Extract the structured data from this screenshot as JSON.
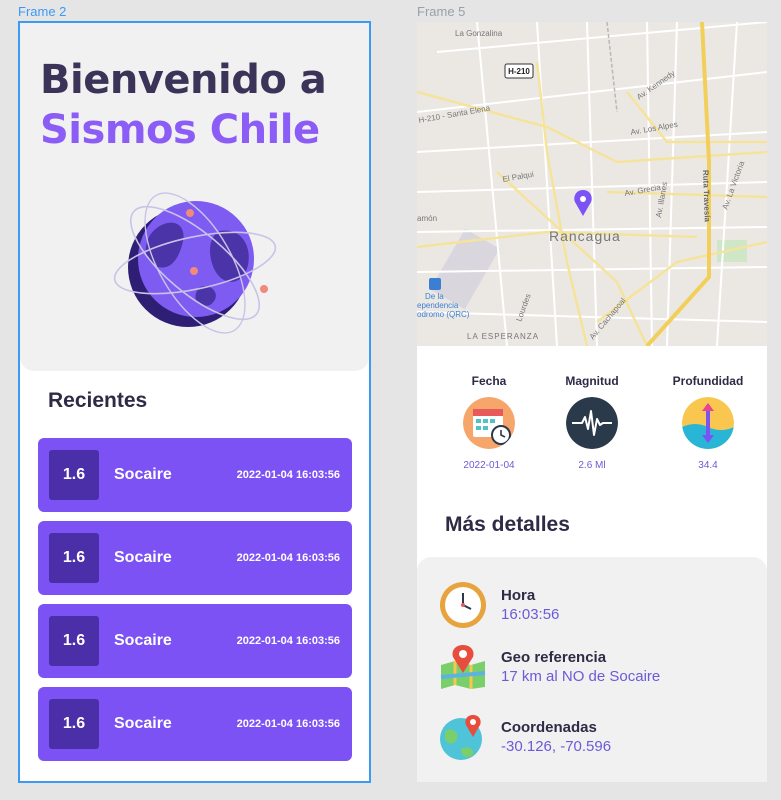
{
  "frames": {
    "frame2_label": "Frame 2",
    "frame5_label": "Frame 5"
  },
  "home": {
    "title_line1": "Bienvenido a",
    "title_line2": "Sismos Chile",
    "recent_heading": "Recientes",
    "recent": [
      {
        "magnitude": "1.6",
        "place": "Socaire",
        "datetime": "2022-01-04 16:03:56"
      },
      {
        "magnitude": "1.6",
        "place": "Socaire",
        "datetime": "2022-01-04 16:03:56"
      },
      {
        "magnitude": "1.6",
        "place": "Socaire",
        "datetime": "2022-01-04 16:03:56"
      },
      {
        "magnitude": "1.6",
        "place": "Socaire",
        "datetime": "2022-01-04 16:03:56"
      }
    ]
  },
  "detail": {
    "map": {
      "city": "Rancagua",
      "road_badge": "H-210",
      "labels": [
        "La Gonzalina",
        "Av. Kennedy",
        "H-210 - Santa Elena",
        "Av. Los Alpes",
        "El Palqui",
        "Av. Grecia",
        "Ruta Travesía",
        "Av. La Victoria",
        "Av. Illanes",
        "amón",
        "De la",
        "ependencia",
        "odromo (QRC)",
        "Lourdes",
        "Av. Cachapoal",
        "LA ESPERANZA"
      ]
    },
    "stats": [
      {
        "label": "Fecha",
        "value": "2022-01-04",
        "icon": "calendar-clock-icon"
      },
      {
        "label": "Magnitud",
        "value": "2.6 Ml",
        "icon": "seismograph-icon"
      },
      {
        "label": "Profundidad",
        "value": "34.4",
        "icon": "depth-water-icon"
      }
    ],
    "more_heading": "Más detalles",
    "details": [
      {
        "label": "Hora",
        "value": "16:03:56",
        "icon": "clock-icon"
      },
      {
        "label": "Geo referencia",
        "value": "17 km al NO de Socaire",
        "icon": "map-pin-icon"
      },
      {
        "label": "Coordenadas",
        "value": "-30.126, -70.596",
        "icon": "globe-pin-icon"
      }
    ]
  },
  "colors": {
    "accent": "#8b5cf6",
    "card": "#7c52f5",
    "card_badge": "#4a2fa8",
    "selection": "#3b9af5"
  }
}
